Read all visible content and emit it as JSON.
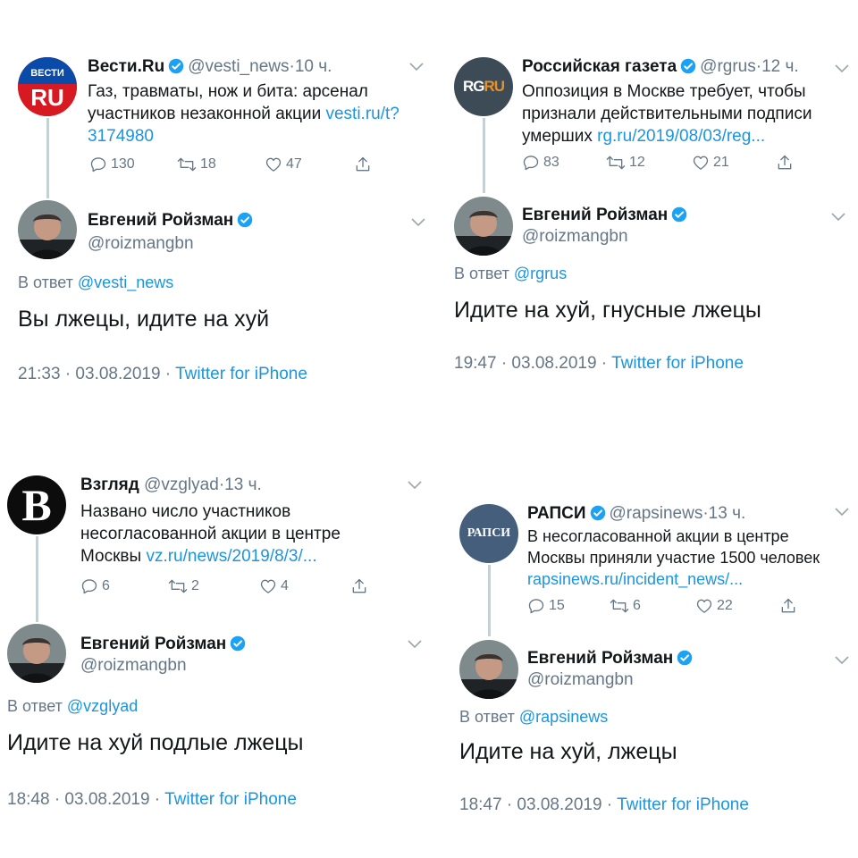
{
  "tweets": [
    {
      "original": {
        "avatar_text": "ВЕСТИ",
        "avatar_text2": "RU",
        "display_name": "Вести.Ru",
        "handle": "@vesti_news",
        "dot": "·",
        "age": "10 ч.",
        "text": "Газ, травматы, нож и бита: арсенал участников незаконной акции",
        "link": "vesti.ru/t?3174980",
        "replies": "130",
        "retweets": "18",
        "likes": "47"
      },
      "reply": {
        "display_name": "Евгений Ройзман",
        "handle": "@roizmangbn",
        "in_reply_prefix": "В ответ",
        "in_reply_to": "@vesti_news",
        "text": "Вы лжецы, идите на хуй",
        "time": "21:33 · 03.08.2019 ·",
        "source": "Twitter for iPhone"
      }
    },
    {
      "original": {
        "avatar_text": "RG",
        "avatar_text2": "RU",
        "display_name": "Российская газета",
        "handle": "@rgrus",
        "dot": "·",
        "age": "12 ч.",
        "text": "Оппозиция в Москве требует, чтобы признали действительными подписи умерших",
        "link": "rg.ru/2019/08/03/reg...",
        "replies": "83",
        "retweets": "12",
        "likes": "21"
      },
      "reply": {
        "display_name": "Евгений Ройзман",
        "handle": "@roizmangbn",
        "in_reply_prefix": "В ответ",
        "in_reply_to": "@rgrus",
        "text": "Идите на хуй, гнусные лжецы",
        "time": "19:47 · 03.08.2019 ·",
        "source": "Twitter for iPhone"
      }
    },
    {
      "original": {
        "avatar_text": "B",
        "display_name": "Взгляд",
        "handle": "@vzglyad",
        "dot": "·",
        "age": "13 ч.",
        "text": "Названо число участников несогласованной акции в центре Москвы",
        "link": "vz.ru/news/2019/8/3/...",
        "replies": "6",
        "retweets": "2",
        "likes": "4"
      },
      "reply": {
        "display_name": "Евгений Ройзман",
        "handle": "@roizmangbn",
        "in_reply_prefix": "В ответ",
        "in_reply_to": "@vzglyad",
        "text": "Идите на хуй подлые лжецы",
        "time": "18:48 · 03.08.2019 ·",
        "source": "Twitter for iPhone"
      }
    },
    {
      "original": {
        "avatar_text": "РАПСИ",
        "display_name": "РАПСИ",
        "handle": "@rapsinews",
        "dot": "·",
        "age": "13 ч.",
        "text": "В несогласованной акции в центре Москвы приняли участие 1500 человек",
        "link": "rapsinews.ru/incident_news/...",
        "replies": "15",
        "retweets": "6",
        "likes": "22"
      },
      "reply": {
        "display_name": "Евгений Ройзман",
        "handle": "@roizmangbn",
        "in_reply_prefix": "В ответ",
        "in_reply_to": "@rapsinews",
        "text": "Идите на хуй, лжецы",
        "time": "18:47 · 03.08.2019 ·",
        "source": "Twitter for iPhone"
      }
    }
  ],
  "colors": {
    "link": "#1b95e0",
    "secondary": "#657786",
    "verified": "#1da1f2",
    "thread_line": "#c4cfd6"
  },
  "icons": [
    "verified-badge-icon",
    "chevron-down-icon",
    "reply-icon",
    "retweet-icon",
    "like-icon",
    "share-icon"
  ]
}
